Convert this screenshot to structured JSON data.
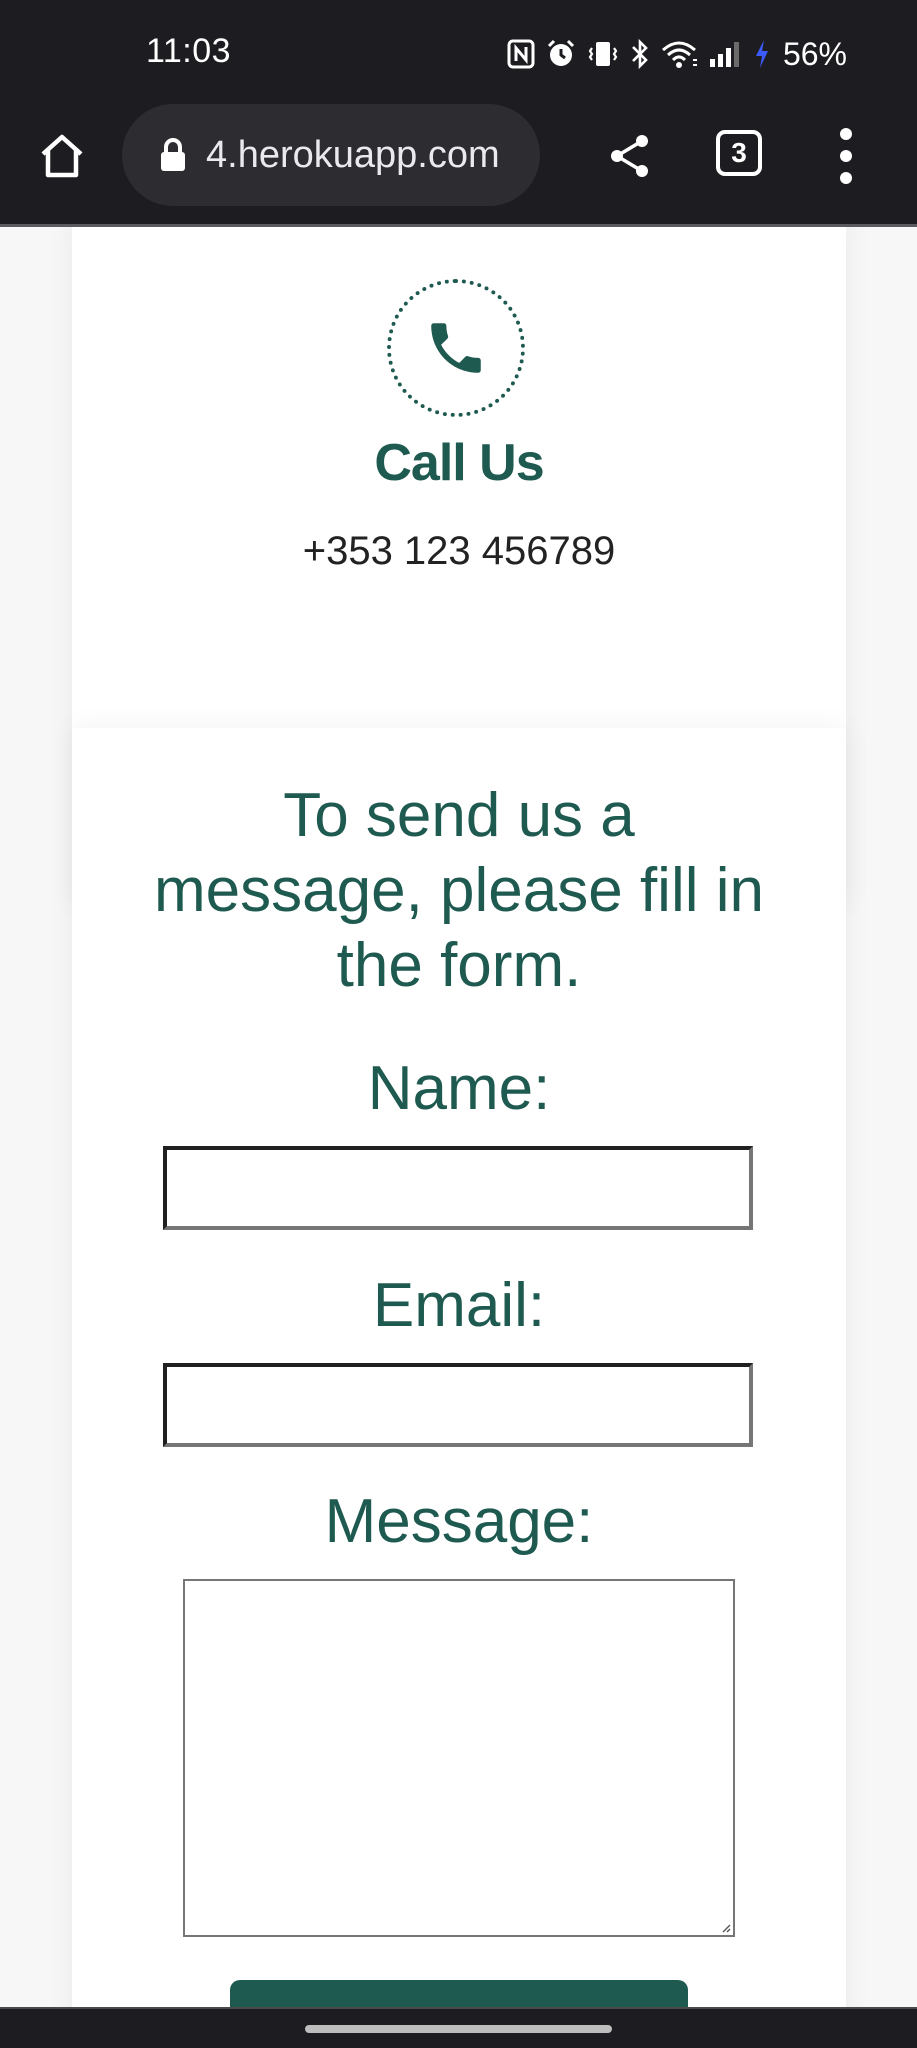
{
  "status_bar": {
    "time": "11:03",
    "battery": "56%",
    "icons": [
      "nfc-icon",
      "alarm-icon",
      "vibrate-icon",
      "bluetooth-icon",
      "wifi-icon",
      "signal-icon",
      "charging-icon"
    ],
    "charging_color": "#3b5bff"
  },
  "browser": {
    "url": "4.herokuapp.com",
    "tab_count": "3",
    "icons": [
      "home-icon",
      "lock-icon",
      "share-icon",
      "more-vert-icon"
    ]
  },
  "call_card": {
    "icon": "phone-icon",
    "title": "Call Us",
    "phone": "+353 123 456789"
  },
  "contact_form": {
    "heading": "To send us a message, please fill in the form.",
    "name_label": "Name:",
    "name_value": "",
    "email_label": "Email:",
    "email_value": "",
    "message_label": "Message:",
    "message_value": ""
  },
  "colors": {
    "brand": "#1e5a50",
    "chrome_bg": "#1d1c20",
    "omnibox_bg": "#2c2c31",
    "page_bg": "#f7f7f7"
  }
}
